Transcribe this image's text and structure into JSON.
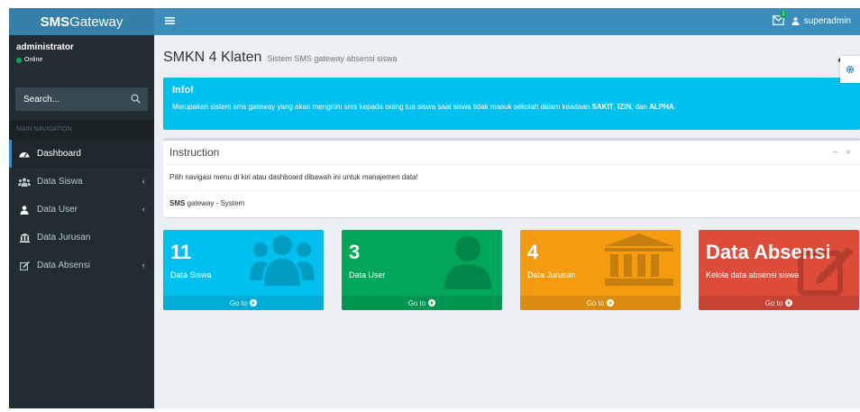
{
  "header": {
    "logo_bold": "SMS",
    "logo_rest": "Gateway",
    "toggle_icon": "bars-icon",
    "notification_count": "1",
    "user_label": "superadmin"
  },
  "sidebar": {
    "user_name": "administrator",
    "user_status": "Online",
    "search_placeholder": "Search...",
    "nav_header": "MAIN NAVIGATION",
    "items": [
      {
        "label": "Dashboard",
        "icon": "dashboard-icon",
        "active": true
      },
      {
        "label": "Data Siswa",
        "icon": "users-icon",
        "has_submenu": true
      },
      {
        "label": "Data User",
        "icon": "user-icon",
        "has_submenu": true
      },
      {
        "label": "Data Jurusan",
        "icon": "bank-icon"
      },
      {
        "label": "Data Absensi",
        "icon": "edit-icon",
        "has_submenu": true
      }
    ]
  },
  "page": {
    "title": "SMKN 4 Klaten",
    "subtitle": "Sistem SMS gateway absensi siswa"
  },
  "info": {
    "title": "Info!",
    "text_before": "Merupakan sistem sms gateway yang akan mengirim sms kepada orang tua siswa saat siswa tidak masuk sekolah dalam keadaan ",
    "bold1": "SAKIT",
    "sep1": ", ",
    "bold2": "IZIN",
    "sep2": ", dan ",
    "bold3": "ALPHA",
    "text_after": "."
  },
  "instruction": {
    "title": "Instruction",
    "body": "Pilih navigasi menu di kiri atau dashboard dibawah ini untuk manajemen data!",
    "footer_bold": "SMS",
    "footer_rest": " gateway - System"
  },
  "tiles": [
    {
      "number": "11",
      "label": "Data Siswa",
      "link": "Go to",
      "color": "#00c0ef",
      "icon": "users-icon"
    },
    {
      "number": "3",
      "label": "Data User",
      "link": "Go to",
      "color": "#00a65a",
      "icon": "user-icon"
    },
    {
      "number": "4",
      "label": "Data Jurusan",
      "link": "Go to",
      "color": "#f39c12",
      "icon": "bank-icon"
    },
    {
      "number": "Data Absensi",
      "label": "Kelola data absensi siswa",
      "link": "Go to",
      "color": "#dd4b39",
      "icon": "edit-icon"
    }
  ]
}
